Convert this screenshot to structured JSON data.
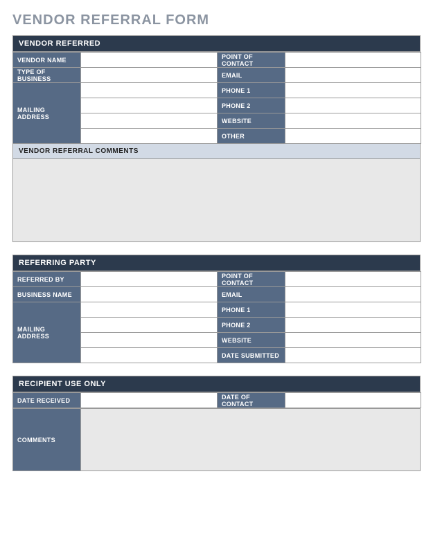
{
  "title": "VENDOR REFERRAL FORM",
  "vendorReferred": {
    "header": "VENDOR REFERRED",
    "vendorName": {
      "label": "VENDOR NAME",
      "value": ""
    },
    "pointOfContact": {
      "label": "POINT OF CONTACT",
      "value": ""
    },
    "typeOfBusiness": {
      "label": "TYPE OF BUSINESS",
      "value": ""
    },
    "email": {
      "label": "EMAIL",
      "value": ""
    },
    "mailingAddress": {
      "label": "MAILING ADDRESS",
      "line1": "",
      "line2": "",
      "line3": "",
      "line4": ""
    },
    "phone1": {
      "label": "PHONE 1",
      "value": ""
    },
    "phone2": {
      "label": "PHONE 2",
      "value": ""
    },
    "website": {
      "label": "WEBSITE",
      "value": ""
    },
    "other": {
      "label": "OTHER",
      "value": ""
    },
    "commentsHeader": "VENDOR REFERRAL COMMENTS",
    "comments": ""
  },
  "referringParty": {
    "header": "REFERRING PARTY",
    "referredBy": {
      "label": "REFERRED BY",
      "value": ""
    },
    "pointOfContact": {
      "label": "POINT OF CONTACT",
      "value": ""
    },
    "businessName": {
      "label": "BUSINESS NAME",
      "value": ""
    },
    "email": {
      "label": "EMAIL",
      "value": ""
    },
    "mailingAddress": {
      "label": "MAILING ADDRESS",
      "line1": "",
      "line2": "",
      "line3": "",
      "line4": ""
    },
    "phone1": {
      "label": "PHONE 1",
      "value": ""
    },
    "phone2": {
      "label": "PHONE 2",
      "value": ""
    },
    "website": {
      "label": "WEBSITE",
      "value": ""
    },
    "dateSubmitted": {
      "label": "DATE SUBMITTED",
      "value": ""
    }
  },
  "recipient": {
    "header": "RECIPIENT USE ONLY",
    "dateReceived": {
      "label": "DATE RECEIVED",
      "value": ""
    },
    "dateOfContact": {
      "label": "DATE OF CONTACT",
      "value": ""
    },
    "comments": {
      "label": "COMMENTS",
      "value": ""
    }
  }
}
